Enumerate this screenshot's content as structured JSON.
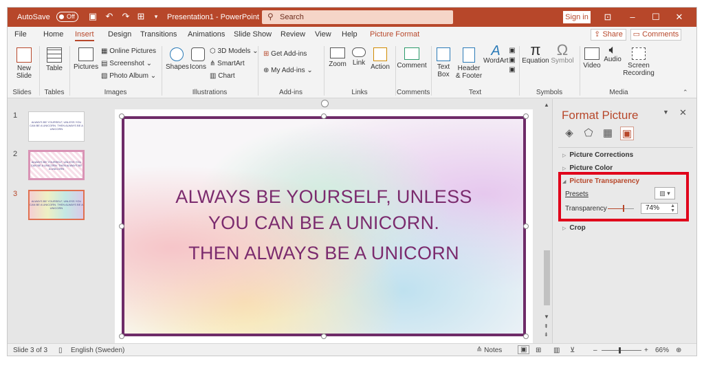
{
  "titlebar": {
    "autosave_label": "AutoSave",
    "autosave_state": "Off",
    "doc_title": "Presentation1 - PowerPoint",
    "search_placeholder": "Search",
    "signin": "Sign in"
  },
  "menu": {
    "items": [
      "File",
      "Home",
      "Insert",
      "Design",
      "Transitions",
      "Animations",
      "Slide Show",
      "Review",
      "View",
      "Help",
      "Picture Format"
    ],
    "active": "Insert",
    "share": "Share",
    "comments": "Comments"
  },
  "ribbon": {
    "new_slide": "New Slide",
    "table": "Table",
    "pictures": "Pictures",
    "online_pictures": "Online Pictures",
    "screenshot": "Screenshot",
    "photo_album": "Photo Album",
    "shapes": "Shapes",
    "icons": "Icons",
    "models_3d": "3D Models",
    "smartart": "SmartArt",
    "chart": "Chart",
    "get_addins": "Get Add-ins",
    "my_addins": "My Add-ins",
    "zoom": "Zoom",
    "link": "Link",
    "action": "Action",
    "comment": "Comment",
    "text_box": "Text Box",
    "header_footer": "Header & Footer",
    "wordart": "WordArt",
    "equation": "Equation",
    "symbol": "Symbol",
    "video": "Video",
    "audio": "Audio",
    "screen_recording": "Screen Recording",
    "groups": [
      "Slides",
      "Tables",
      "Images",
      "Illustrations",
      "Add-ins",
      "Links",
      "Comments",
      "Text",
      "Symbols",
      "Media"
    ]
  },
  "thumbnails": [
    {
      "num": "1",
      "text": "ALWAYS BE YOURSELF, UNLESS YOU CAN BE A UNICORN. THEN ALWAYS BE A UNICORN"
    },
    {
      "num": "2",
      "text": "ALWAYS BE YOURSELF, UNLESS YOU CAN BE A UNICORN. THEN ALWAYS BE A UNICORN"
    },
    {
      "num": "3",
      "text": "ALWAYS BE YOURSELF, UNLESS YOU CAN BE A UNICORN. THEN ALWAYS BE A UNICORN"
    }
  ],
  "slide": {
    "line1": "ALWAYS BE YOURSELF, UNLESS",
    "line2": "YOU CAN BE A UNICORN.",
    "line3": "THEN ALWAYS BE A UNICORN"
  },
  "pane": {
    "title": "Format Picture",
    "sections": {
      "corrections": "Picture Corrections",
      "color": "Picture Color",
      "transparency": "Picture Transparency",
      "crop": "Crop"
    },
    "presets_label": "Presets",
    "transparency_label": "Transparency",
    "transparency_value": "74%",
    "transparency_level": 0.74
  },
  "status": {
    "slide_info": "Slide 3 of 3",
    "language": "English (Sweden)",
    "notes": "Notes",
    "zoom": "66%"
  },
  "colors": {
    "accent": "#b7472a",
    "highlight_box": "#e0001a",
    "text_purple": "#7b2b6e"
  }
}
